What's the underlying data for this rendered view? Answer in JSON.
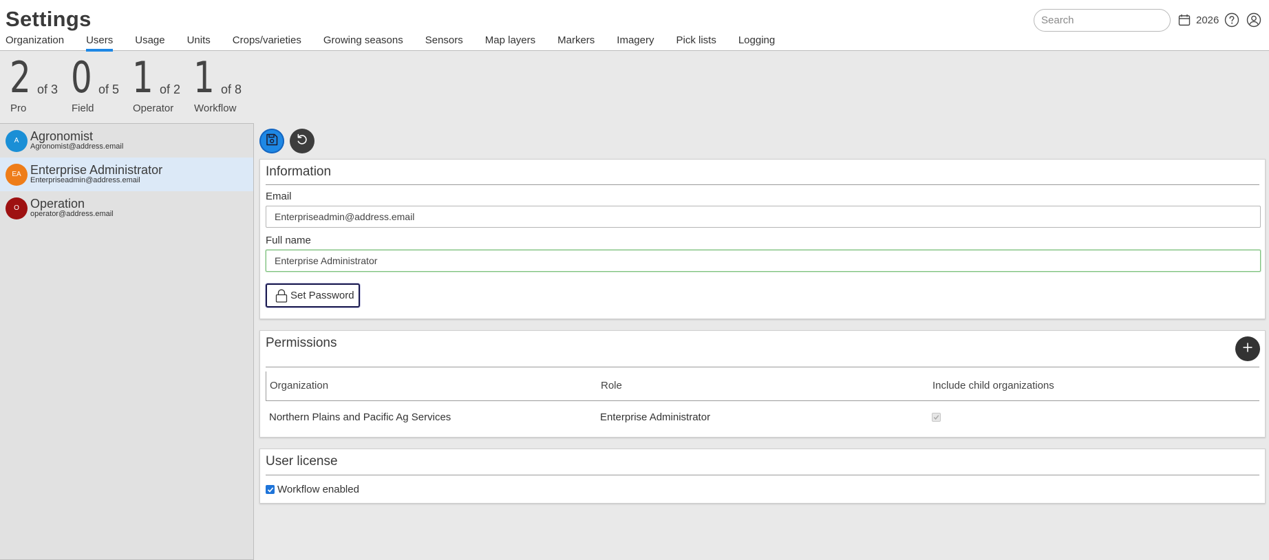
{
  "header": {
    "title": "Settings",
    "tabs": [
      {
        "label": "Organization",
        "active": false
      },
      {
        "label": "Users",
        "active": true
      },
      {
        "label": "Usage",
        "active": false
      },
      {
        "label": "Units",
        "active": false
      },
      {
        "label": "Crops/varieties",
        "active": false
      },
      {
        "label": "Growing seasons",
        "active": false
      },
      {
        "label": "Sensors",
        "active": false
      },
      {
        "label": "Map layers",
        "active": false
      },
      {
        "label": "Markers",
        "active": false
      },
      {
        "label": "Imagery",
        "active": false
      },
      {
        "label": "Pick lists",
        "active": false
      },
      {
        "label": "Logging",
        "active": false
      }
    ],
    "search": {
      "placeholder": "Search",
      "value": ""
    },
    "year": "2026",
    "icons": {
      "calendar": "calendar-icon",
      "help": "help-icon",
      "account": "account-icon"
    }
  },
  "license_stats": [
    {
      "count": "2",
      "of": "of 3",
      "label": "Pro"
    },
    {
      "count": "0",
      "of": "of 5",
      "label": "Field"
    },
    {
      "count": "1",
      "of": "of 2",
      "label": "Operator"
    },
    {
      "count": "1",
      "of": "of 8",
      "label": "Workflow"
    }
  ],
  "users": [
    {
      "initials": "A",
      "name": "Agronomist",
      "email": "Agronomist@address.email",
      "color": "#1a8fd6",
      "selected": false
    },
    {
      "initials": "EA",
      "name": "Enterprise Administrator",
      "email": "Enterpriseadmin@address.email",
      "color": "#ee7d1a",
      "selected": true
    },
    {
      "initials": "O",
      "name": "Operation",
      "email": "operator@address.email",
      "color": "#9e1111",
      "selected": false
    }
  ],
  "toolbar": {
    "save_icon": "save-icon",
    "undo_icon": "undo-icon"
  },
  "information": {
    "title": "Information",
    "email_label": "Email",
    "email_value": "Enterpriseadmin@address.email",
    "fullname_label": "Full name",
    "fullname_value": "Enterprise Administrator",
    "set_password_label": "Set Password"
  },
  "permissions": {
    "title": "Permissions",
    "columns": [
      "Organization",
      "Role",
      "Include child organizations"
    ],
    "rows": [
      {
        "organization": "Northern Plains and Pacific Ag Services",
        "role": "Enterprise Administrator",
        "include_children": true
      }
    ]
  },
  "user_license": {
    "title": "User license",
    "workflow_label": "Workflow enabled",
    "workflow_enabled": true
  },
  "colors": {
    "accent": "#1e88e5",
    "selected_row": "#dce9f7",
    "dark_button": "#3d3d3d"
  }
}
